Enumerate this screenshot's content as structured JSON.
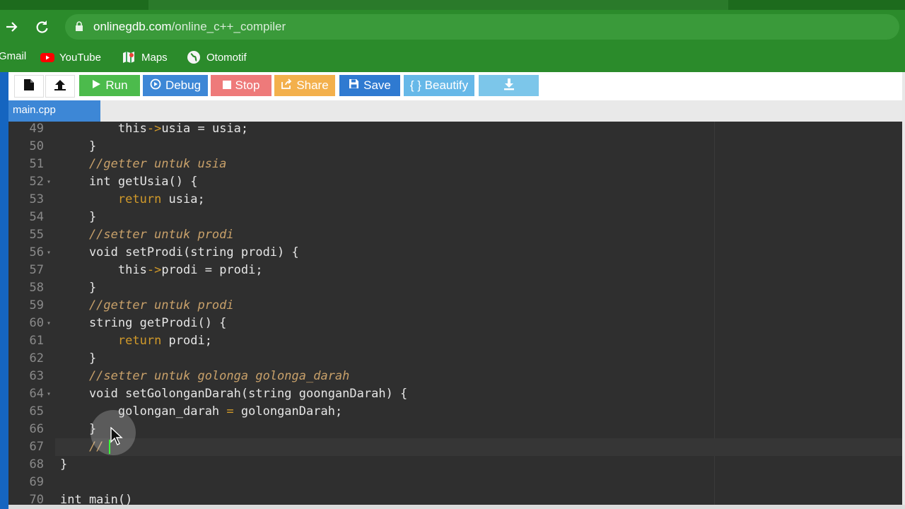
{
  "browser": {
    "url_host": "onlinegdb.com",
    "url_path": "/online_c++_compiler",
    "bookmarks": [
      {
        "label": "Gmail",
        "icon": "gmail-icon"
      },
      {
        "label": "YouTube",
        "icon": "youtube-icon"
      },
      {
        "label": "Maps",
        "icon": "maps-icon"
      },
      {
        "label": "Otomotif",
        "icon": "globe-icon"
      }
    ]
  },
  "toolbar": {
    "run_label": "Run",
    "debug_label": "Debug",
    "stop_label": "Stop",
    "share_label": "Share",
    "save_label": "Save",
    "beautify_label": "{ } Beautify",
    "colors": {
      "run": "#4cbb4c",
      "debug": "#3d87d6",
      "stop": "#ee7a7a",
      "share": "#f3b04c",
      "save": "#2f7ad1",
      "beautify": "#66b8e8",
      "download": "#7cc6ea"
    }
  },
  "file_tab": {
    "label": "main.cpp"
  },
  "editor": {
    "active_line": 67,
    "lines": [
      {
        "n": "49",
        "fold": false
      },
      {
        "n": "50",
        "fold": false
      },
      {
        "n": "51",
        "fold": false
      },
      {
        "n": "52",
        "fold": true
      },
      {
        "n": "53",
        "fold": false
      },
      {
        "n": "54",
        "fold": false
      },
      {
        "n": "55",
        "fold": false
      },
      {
        "n": "56",
        "fold": true
      },
      {
        "n": "57",
        "fold": false
      },
      {
        "n": "58",
        "fold": false
      },
      {
        "n": "59",
        "fold": false
      },
      {
        "n": "60",
        "fold": true
      },
      {
        "n": "61",
        "fold": false
      },
      {
        "n": "62",
        "fold": false
      },
      {
        "n": "63",
        "fold": false
      },
      {
        "n": "64",
        "fold": true
      },
      {
        "n": "65",
        "fold": false
      },
      {
        "n": "66",
        "fold": false
      },
      {
        "n": "67",
        "fold": false
      },
      {
        "n": "68",
        "fold": false
      },
      {
        "n": "69",
        "fold": false
      },
      {
        "n": "70",
        "fold": false
      }
    ],
    "code": {
      "l49a": "        this",
      "l49b": "->",
      "l49c": "usia = usia;",
      "l50": "    }",
      "l51": "    //getter untuk usia",
      "l52": "    int getUsia() {",
      "l53a": "        ",
      "l53b": "return",
      "l53c": " usia;",
      "l54": "    }",
      "l55": "    //setter untuk prodi",
      "l56": "    void setProdi(string prodi) {",
      "l57a": "        this",
      "l57b": "->",
      "l57c": "prodi = prodi;",
      "l58": "    }",
      "l59": "    //getter untuk prodi",
      "l60": "    string getProdi() {",
      "l61a": "        ",
      "l61b": "return",
      "l61c": " prodi;",
      "l62": "    }",
      "l63": "    //setter untuk golonga golonga_darah",
      "l64": "    void setGolonganDarah(string goonganDarah) {",
      "l65a": "        golongan_darah ",
      "l65b": "=",
      "l65c": " golonganDarah;",
      "l66": "    }",
      "l67": "    //",
      "l68": "}",
      "l69": "",
      "l70": "int main()"
    }
  }
}
